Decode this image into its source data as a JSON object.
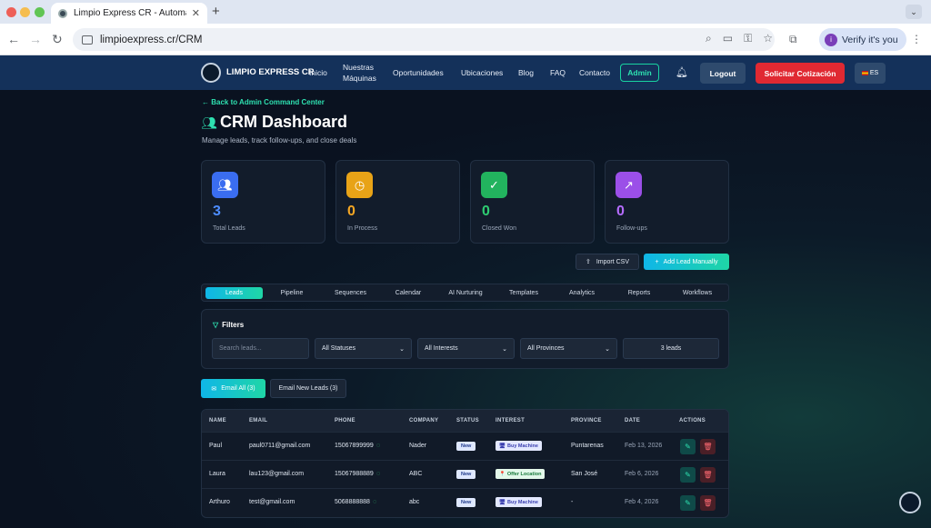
{
  "browser": {
    "tab_title": "Limpio Express CR - Automat",
    "url": "limpioexpress.cr/CRM",
    "verify_label": "Verify it's you",
    "avatar_letter": "i"
  },
  "header": {
    "brand": "LIMPIO EXPRESS CR",
    "nav": [
      "Inicio",
      "Nuestras",
      "Máquinas",
      "Oportunidades",
      "Ubicaciones",
      "Blog",
      "FAQ",
      "Contacto"
    ],
    "admin": "Admin",
    "logout": "Logout",
    "quote": "Solicitar Cotización",
    "lang": "ES"
  },
  "page": {
    "back": "Back to Admin Command Center",
    "title": "CRM Dashboard",
    "subtitle": "Manage leads, track follow-ups, and close deals"
  },
  "stats": [
    {
      "value": "3",
      "label": "Total Leads",
      "color": "#4d8dff",
      "icon_bg": "#3a6df0",
      "icon": "users-icon"
    },
    {
      "value": "0",
      "label": "In Process",
      "color": "#f5a623",
      "icon_bg": "#e8a317",
      "icon": "clock-icon"
    },
    {
      "value": "0",
      "label": "Closed Won",
      "color": "#2ecc71",
      "icon_bg": "#22b35e",
      "icon": "check-circle-icon"
    },
    {
      "value": "0",
      "label": "Follow-ups",
      "color": "#b56cff",
      "icon_bg": "#9b4fe8",
      "icon": "trending-up-icon"
    }
  ],
  "actions": {
    "import": "Import CSV",
    "add": "Add Lead Manually"
  },
  "tabs": [
    "Leads",
    "Pipeline",
    "Sequences",
    "Calendar",
    "AI Nurturing",
    "Templates",
    "Analytics",
    "Reports",
    "Workflows"
  ],
  "filters": {
    "title": "Filters",
    "search_placeholder": "Search leads...",
    "status": "All Statuses",
    "interest": "All Interests",
    "province": "All Provinces",
    "count": "3 leads"
  },
  "email_buttons": {
    "all": "Email All (3)",
    "new": "Email New Leads (3)"
  },
  "table": {
    "headers": [
      "NAME",
      "EMAIL",
      "PHONE",
      "COMPANY",
      "STATUS",
      "INTEREST",
      "PROVINCE",
      "DATE",
      "ACTIONS"
    ],
    "rows": [
      {
        "name": "Paul",
        "email": "paul0711@gmail.com",
        "phone": "15067899999",
        "company": "Nader",
        "status": "New",
        "interest": "Buy Machine",
        "interest_icon": "🖥",
        "province": "Puntarenas",
        "date": "Feb 13, 2026"
      },
      {
        "name": "Laura",
        "email": "lau123@gmail.com",
        "phone": "15067988889",
        "company": "ABC",
        "status": "New",
        "interest": "Offer Location",
        "interest_icon": "📍",
        "province": "San José",
        "date": "Feb 6, 2026"
      },
      {
        "name": "Arthuro",
        "email": "test@gmail.com",
        "phone": "5068888888",
        "company": "abc",
        "status": "New",
        "interest": "Buy Machine",
        "interest_icon": "🖥",
        "province": "-",
        "date": "Feb 4, 2026"
      }
    ]
  }
}
